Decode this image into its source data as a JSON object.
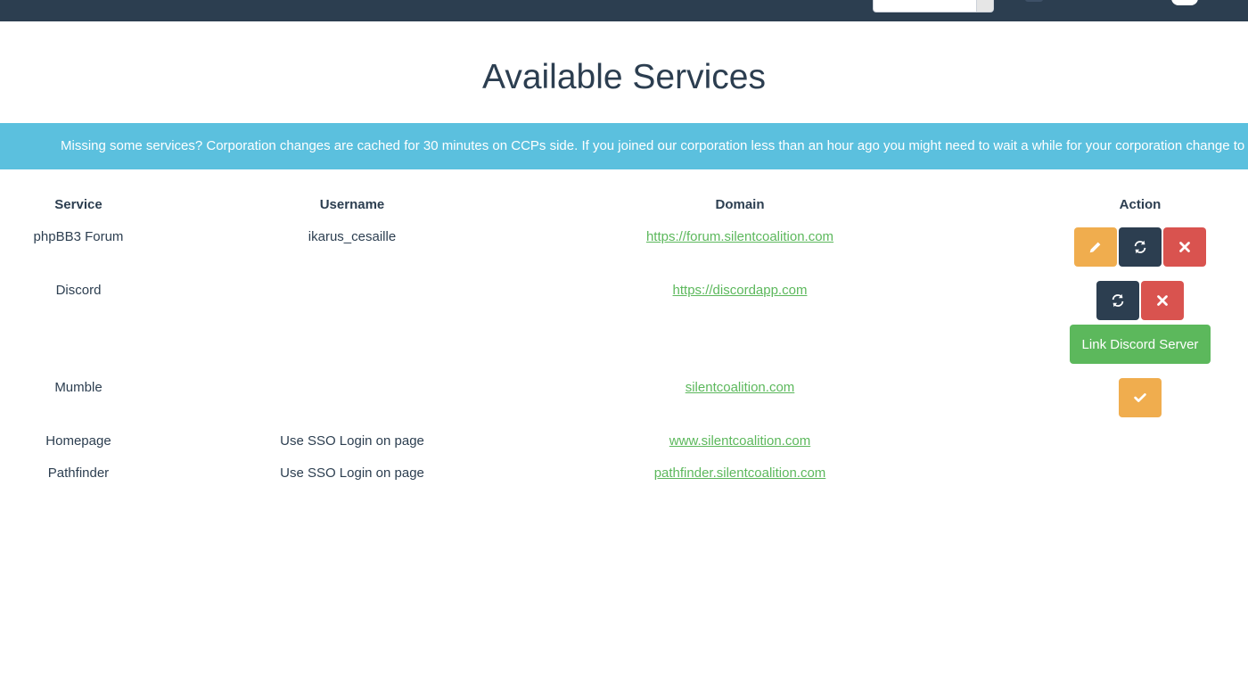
{
  "page": {
    "title": "Available Services"
  },
  "banner": {
    "text": "Missing some services? Corporation changes are cached for 30 minutes on CCPs side. If you joined our corporation less than an hour ago you might need to wait a while for your corporation change to update"
  },
  "table": {
    "headers": {
      "service": "Service",
      "username": "Username",
      "domain": "Domain",
      "action": "Action"
    },
    "rows": [
      {
        "service": "phpBB3 Forum",
        "username": "ikarus_cesaille",
        "domain": "https://forum.silentcoalition.com"
      },
      {
        "service": "Discord",
        "username": "",
        "domain": "https://discordapp.com"
      },
      {
        "service": "Mumble",
        "username": "",
        "domain": "silentcoalition.com"
      },
      {
        "service": "Homepage",
        "username": "Use SSO Login on page",
        "domain": "www.silentcoalition.com"
      },
      {
        "service": "Pathfinder",
        "username": "Use SSO Login on page",
        "domain": "pathfinder.silentcoalition.com"
      }
    ]
  },
  "actions": {
    "link_discord_label": "Link Discord Server",
    "icons": [
      "pencil-icon",
      "refresh-icon",
      "close-icon",
      "checkmark-icon"
    ]
  },
  "colors": {
    "navbar": "#2c3e50",
    "info": "#5bc0de",
    "warning": "#f0ad4e",
    "danger": "#d9534f",
    "success": "#5cb85c",
    "primary": "#2c3e50"
  }
}
